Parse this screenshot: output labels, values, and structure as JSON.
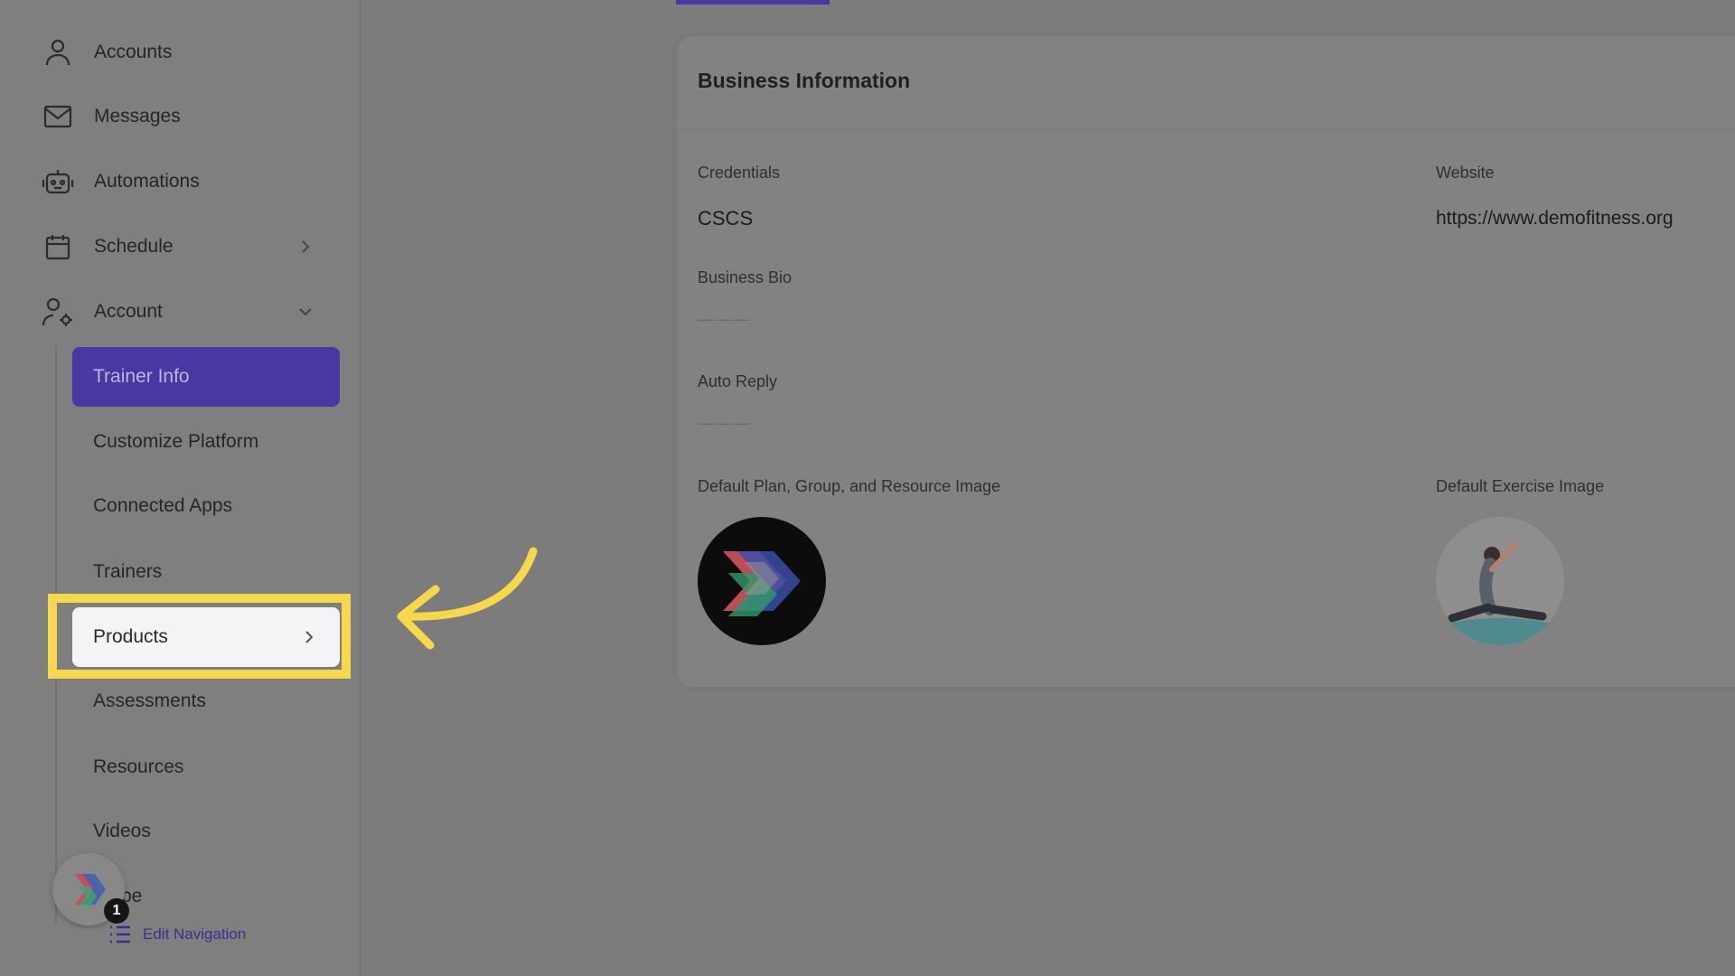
{
  "sidebar": {
    "items": [
      {
        "label": "Accounts",
        "icon": "user-icon"
      },
      {
        "label": "Messages",
        "icon": "mail-icon"
      },
      {
        "label": "Automations",
        "icon": "robot-icon"
      },
      {
        "label": "Schedule",
        "icon": "calendar-icon"
      },
      {
        "label": "Account",
        "icon": "user-settings-icon"
      }
    ],
    "sub_items": [
      {
        "label": "Trainer Info"
      },
      {
        "label": "Customize Platform"
      },
      {
        "label": "Connected Apps"
      },
      {
        "label": "Trainers"
      },
      {
        "label": "Products"
      },
      {
        "label": "Assessments"
      },
      {
        "label": "Resources"
      },
      {
        "label": "Videos"
      }
    ],
    "partial_item_label": "pe",
    "help_badge_count": "1",
    "edit_navigation_label": "Edit Navigation"
  },
  "card": {
    "title": "Business Information",
    "credentials_label": "Credentials",
    "credentials_value": "CSCS",
    "website_label": "Website",
    "website_value": "https://www.demofitness.org",
    "business_bio_label": "Business Bio",
    "business_bio_value": "———",
    "auto_reply_label": "Auto Reply",
    "auto_reply_value": "———",
    "default_image_label": "Default Plan, Group, and Resource Image",
    "default_exercise_label": "Default Exercise Image"
  },
  "colors": {
    "accent": "#4a37a2",
    "highlight_border": "#f7d84a",
    "overlay_bg": "#7c7c7c"
  }
}
